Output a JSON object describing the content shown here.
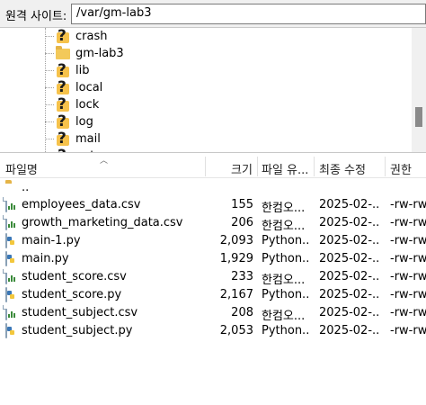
{
  "remote_site": {
    "label": "원격 사이트:",
    "path": "/var/gm-lab3"
  },
  "tree": {
    "items": [
      {
        "label": "crash",
        "icon": "unknown-folder-icon"
      },
      {
        "label": "gm-lab3",
        "icon": "folder-icon"
      },
      {
        "label": "lib",
        "icon": "unknown-folder-icon"
      },
      {
        "label": "local",
        "icon": "unknown-folder-icon"
      },
      {
        "label": "lock",
        "icon": "unknown-folder-icon"
      },
      {
        "label": "log",
        "icon": "unknown-folder-icon"
      },
      {
        "label": "mail",
        "icon": "unknown-folder-icon"
      },
      {
        "label": "opt",
        "icon": "unknown-folder-icon"
      }
    ]
  },
  "file_list": {
    "columns": {
      "name": "파일명",
      "size": "크기",
      "type": "파일 유...",
      "modified": "최종 수정",
      "perms": "권한"
    },
    "parent": "..",
    "files": [
      {
        "name": "employees_data.csv",
        "size": "155",
        "type": "한컴오...",
        "modified": "2025-02-...",
        "perms": "-rw-rw",
        "icon": "csv-file-icon"
      },
      {
        "name": "growth_marketing_data.csv",
        "size": "206",
        "type": "한컴오...",
        "modified": "2025-02-...",
        "perms": "-rw-rw",
        "icon": "csv-file-icon"
      },
      {
        "name": "main-1.py",
        "size": "2,093",
        "type": "Python...",
        "modified": "2025-02-...",
        "perms": "-rw-rw",
        "icon": "python-file-icon"
      },
      {
        "name": "main.py",
        "size": "1,929",
        "type": "Python...",
        "modified": "2025-02-...",
        "perms": "-rw-rw",
        "icon": "python-file-icon"
      },
      {
        "name": "student_score.csv",
        "size": "233",
        "type": "한컴오...",
        "modified": "2025-02-...",
        "perms": "-rw-rw",
        "icon": "csv-file-icon"
      },
      {
        "name": "student_score.py",
        "size": "2,167",
        "type": "Python...",
        "modified": "2025-02-...",
        "perms": "-rw-rw",
        "icon": "python-file-icon"
      },
      {
        "name": "student_subject.csv",
        "size": "208",
        "type": "한컴오...",
        "modified": "2025-02-...",
        "perms": "-rw-rw",
        "icon": "csv-file-icon"
      },
      {
        "name": "student_subject.py",
        "size": "2,053",
        "type": "Python...",
        "modified": "2025-02-...",
        "perms": "-rw-rw",
        "icon": "python-file-icon"
      }
    ]
  }
}
